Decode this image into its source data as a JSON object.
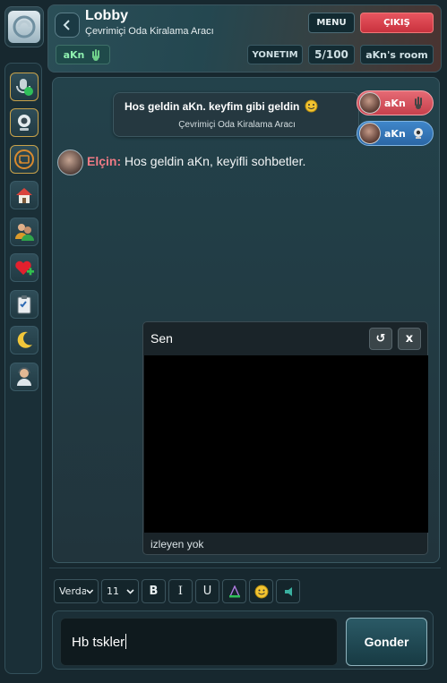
{
  "colors": {
    "accent_teal": "#2b5a66",
    "exit_red": "#d63c47",
    "user_green": "#8ff0b0",
    "nick_pink": "#f07b85",
    "chip_red": "#d85562",
    "chip_blue": "#3476b8"
  },
  "header": {
    "title": "Lobby",
    "subtitle": "Çevrimiçi Oda Kiralama Aracı",
    "menu_label": "MENU",
    "exit_label": "ÇIKIŞ",
    "user_label": "aKn",
    "admin_label": "YONETIM",
    "count_label": "5/100",
    "room_label": "aKn's room"
  },
  "sidebar": {
    "logo_icon": "logo-icon",
    "items": [
      {
        "icon": "hand-mic-icon",
        "active": true
      },
      {
        "icon": "webcam-icon",
        "active": true
      },
      {
        "icon": "cast-icon",
        "active": true
      },
      {
        "icon": "home-icon",
        "active": false
      },
      {
        "icon": "users-icon",
        "active": false
      },
      {
        "icon": "heart-plus-icon",
        "active": false
      },
      {
        "icon": "clipboard-icon",
        "active": false
      },
      {
        "icon": "moon-icon",
        "active": false
      },
      {
        "icon": "agent-icon",
        "active": false
      }
    ]
  },
  "chat": {
    "welcome_line1": "Hos geldin aKn. keyfim gibi geldin",
    "welcome_line2": "Çevrimiçi Oda Kiralama Aracı",
    "user_chips": [
      {
        "name": "aKn",
        "color": "red"
      },
      {
        "name": "aKn",
        "color": "blue"
      }
    ],
    "message": {
      "nick": "Elçin:",
      "text": "Hos geldin aKn, keyifli sohbetler."
    }
  },
  "video": {
    "title": "Sen",
    "refresh_glyph": "↺",
    "close_glyph": "x",
    "footer": "izleyen yok"
  },
  "toolbar": {
    "font": "Verdana",
    "size": "11",
    "bold": "B",
    "italic": "I",
    "underline": "U"
  },
  "composer": {
    "value": "Hb tskler",
    "send_label": "Gonder"
  }
}
